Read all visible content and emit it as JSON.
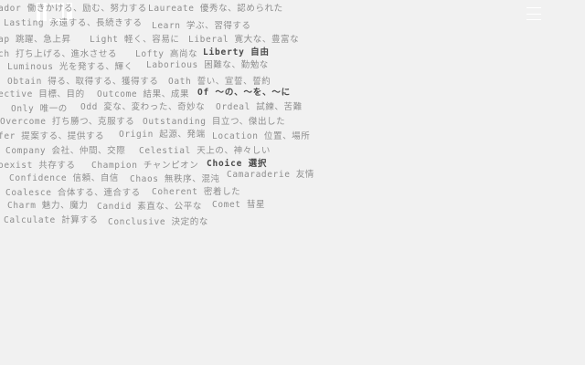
{
  "header": {
    "logo_icon": "brand-logo-icon",
    "menu_icon": "hamburger-menu-icon"
  },
  "words": [
    {
      "text": "ador 働きかける、励む、努力する"
    },
    {
      "text": "Laureate 優秀な、認められた"
    },
    {
      "text": "Lasting 永遠する、長続きする"
    },
    {
      "text": "Learn 学ぶ、習得する"
    },
    {
      "text": "ap 跳躍、急上昇"
    },
    {
      "text": "Light 軽く、容易に"
    },
    {
      "text": "Liberal 寛大な、豊富な"
    },
    {
      "text": "ch 打ち上げる、進水させる"
    },
    {
      "text": "Lofty 高尚な"
    },
    {
      "text": "Liberty 自由"
    },
    {
      "text": "Luminous 光を発する、輝く"
    },
    {
      "text": "Laborious 困難な、勤勉な"
    },
    {
      "text": "Obtain 得る、取得する、獲得する"
    },
    {
      "text": "Oath 誓い、宣誓、誓約"
    },
    {
      "text": "ective 目標、目的"
    },
    {
      "text": "Outcome 結果、成果"
    },
    {
      "text": "Of 〜の、〜を、〜に"
    },
    {
      "text": "Only 唯一の"
    },
    {
      "text": "Odd 変な、変わった、奇妙な"
    },
    {
      "text": "Ordeal 試練、苦難"
    },
    {
      "text": "Overcome 打ち勝つ、克服する"
    },
    {
      "text": "Outstanding 目立つ、傑出した"
    },
    {
      "text": "fer 提案する、提供する"
    },
    {
      "text": "Origin 起源、発端"
    },
    {
      "text": "Location 位置、場所"
    },
    {
      "text": "Company 会社、仲間、交際"
    },
    {
      "text": "Celestial 天上の、神々しい"
    },
    {
      "text": "oexist 共存する"
    },
    {
      "text": "Champion チャンピオン"
    },
    {
      "text": "Choice 選択"
    },
    {
      "text": "Confidence 信頼、自信"
    },
    {
      "text": "Chaos 無秩序、混沌"
    },
    {
      "text": "Camaraderie 友情"
    },
    {
      "text": "Coalesce 合体する、連合する"
    },
    {
      "text": "Coherent 密着した"
    },
    {
      "text": "Charm 魅力、魔力"
    },
    {
      "text": "Candid 素直な、公平な"
    },
    {
      "text": "Comet 彗星"
    },
    {
      "text": "Calculate 計算する"
    },
    {
      "text": "Conclusive 決定的な"
    }
  ]
}
